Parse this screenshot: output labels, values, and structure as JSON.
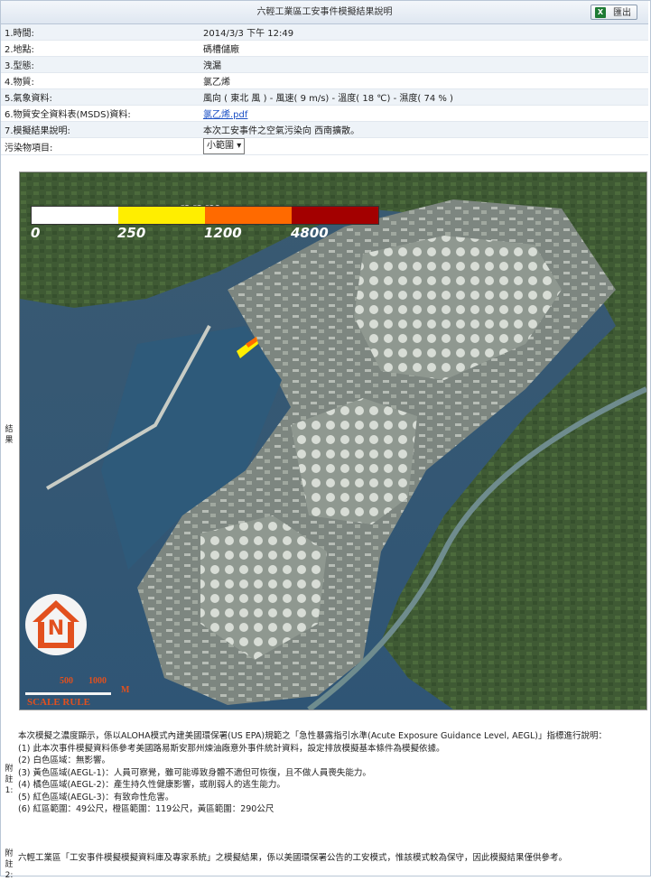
{
  "header": {
    "title": "六輕工業區工安事件模擬結果說明",
    "export_label": "匯出",
    "export_icon": "excel-icon"
  },
  "info_rows": [
    {
      "label": "1.時間:",
      "value": "2014/3/3 下午 12:49"
    },
    {
      "label": "2.地點:",
      "value": "碼槽儲廠"
    },
    {
      "label": "3.型態:",
      "value": "洩漏"
    },
    {
      "label": "4.物質:",
      "value": "氯乙烯"
    },
    {
      "label": "5.氣象資料:",
      "value": "風向 ( 東北 風 ) - 風速( 9 m/s) - 溫度( 18 ℃) - 濕度( 74 % )"
    },
    {
      "label": "6.物質安全資料表(MSDS)資料:",
      "value": "氯乙烯.pdf"
    },
    {
      "label": "7.模擬結果說明:",
      "value": "本次工安事件之空氣污染向 西南擴散。"
    },
    {
      "label": "污染物項目:",
      "value": "小範圍"
    }
  ],
  "side_labels": {
    "result": "結果",
    "note1": "附註1:",
    "note2": "附註2:"
  },
  "map": {
    "legend_unit": "ppm",
    "legend_ticks": [
      "0",
      "250",
      "1200",
      "4800"
    ],
    "legend_colors": [
      "#ffffff",
      "#ffee00",
      "#ff6a00",
      "#a30000"
    ],
    "north_label": "N",
    "scale_labels": {
      "a": "500",
      "b": "1000",
      "unit": "M",
      "rule": "SCALE RULE"
    }
  },
  "notes": {
    "intro": "本次模擬之濃度顯示，係以ALOHA模式內建美國環保署(US EPA)規範之「急性暴露指引水準(Acute Exposure Guidance Level, AEGL)」指標進行說明：",
    "items": [
      "(1) 此本次事件模擬資料係參考美國路易斯安那州煉油廠意外事件統計資料，設定排放模擬基本條件為模擬依據。",
      "(2) 白色區域：無影響。",
      "(3) 黃色區域(AEGL-1)：人員可察覺，雖可能導致身體不適但可恢復，且不做人員喪失能力。",
      "(4) 橘色區域(AEGL-2)：產生持久性健康影響，或削弱人的逃生能力。",
      "(5) 紅色區域(AEGL-3)：有致命性危害。",
      "(6) 紅區範圍：49公尺，橙區範圍：119公尺，黃區範圍：290公尺"
    ],
    "disclaimer": "六輕工業區「工安事件模擬模擬資料庫及專家系統」之模擬結果，係以美國環保署公告的工安模式，惟該模式較為保守，因此模擬結果僅供參考。"
  }
}
